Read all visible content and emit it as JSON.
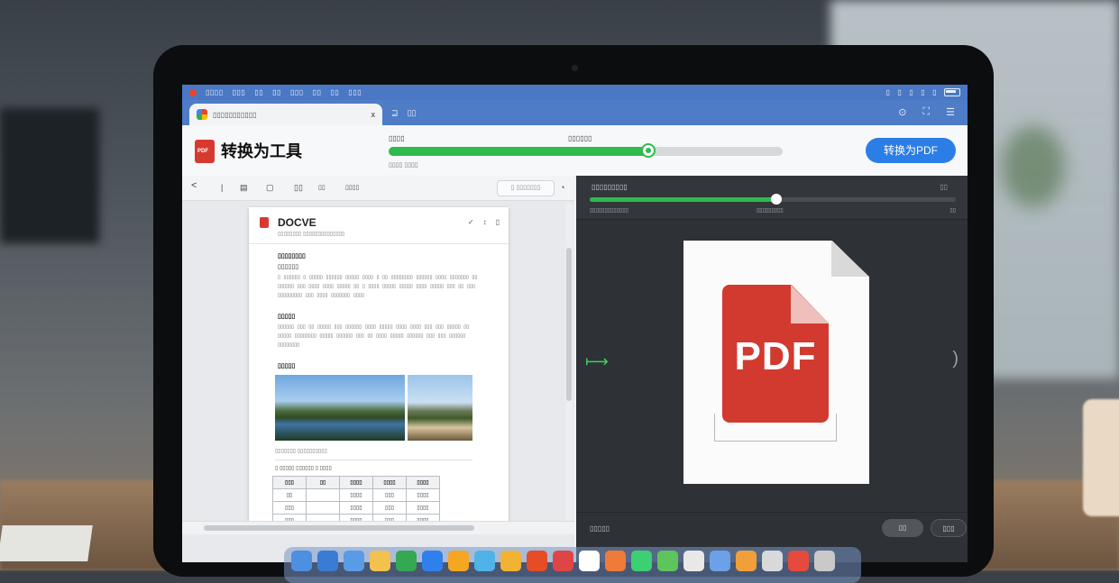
{
  "menubar": {
    "items": [
      "▯▯▯▯",
      "▯▯▯",
      "▯▯",
      "▯▯",
      "▯▯▯",
      "▯▯",
      "▯▯",
      "▯▯▯"
    ],
    "status_icons": [
      "▯",
      "▯",
      "▯",
      "▯",
      "▯"
    ]
  },
  "tab": {
    "label": "▯▯▯▯▯▯▯▯▯▯▯",
    "close": "x",
    "extra_icons": [
      "⊒",
      "▯▯"
    ]
  },
  "toolbar_right": [
    "⊙",
    "⛶",
    "☰"
  ],
  "header": {
    "app_title": "转换为工具",
    "progress_label_left": "▯▯▯▯",
    "progress_label_right": "▯▯▯▯▯▯",
    "progress_sub": "▯▯▯▯ ▯▯▯▯",
    "progress_value": 0.66,
    "convert_button": "转换为PDF"
  },
  "left_toolbar": {
    "back": "<",
    "sep": "|",
    "icons": [
      "▤",
      "▢",
      "▯▯"
    ],
    "labels": [
      "▯▯",
      "▯▯▯▯"
    ],
    "search_placeholder": "▯ ▯▯▯▯▯▯▯"
  },
  "document": {
    "title": "DOCVE",
    "subtitle": "▯▯▯▯▯▯▯▯ ▯▯▯▯▯▯▯▯▯▯▯▯▯▯",
    "tools": [
      "✓",
      "↕",
      "▯"
    ],
    "heading1": "▯▯▯▯▯▯▯▯",
    "heading1b": "▯▯▯▯▯▯",
    "para1": "▯ ▯▯▯▯▯▯ ▯ ▯▯▯▯▯ ▯▯▯▯▯▯ ▯▯▯▯▯ ▯▯▯▯ ▯ ▯▯ ▯▯▯▯▯▯▯▯ ▯▯▯▯▯▯ ▯▯▯▯ ▯▯▯▯▯▯▯ ▯▯ ▯▯▯▯▯▯ ▯▯▯ ▯▯▯▯ ▯▯▯▯ ▯▯▯▯▯ ▯▯ ▯ ▯▯▯▯ ▯▯▯▯▯ ▯▯▯▯▯ ▯▯▯▯ ▯▯▯▯▯ ▯▯▯ ▯▯ ▯▯▯ ▯▯▯▯▯▯▯▯▯ ▯▯▯ ▯▯▯▯ ▯▯▯▯▯▯▯ ▯▯▯▯",
    "heading2": "▯▯▯▯▯",
    "para2": "▯▯▯▯▯▯ ▯▯▯ ▯▯ ▯▯▯▯▯ ▯▯▯ ▯▯▯▯▯▯ ▯▯▯▯ ▯▯▯▯▯ ▯▯▯▯ ▯▯▯▯ ▯▯▯ ▯▯▯ ▯▯▯▯▯ ▯▯ ▯▯▯▯▯ ▯▯▯▯▯▯▯▯ ▯▯▯▯▯ ▯▯▯▯▯▯ ▯▯▯ ▯▯ ▯▯▯▯ ▯▯▯▯▯ ▯▯▯▯▯▯ ▯▯▯ ▯▯▯ ▯▯▯▯▯▯ ▯▯▯▯▯▯▯▯",
    "heading3": "▯▯▯▯▯",
    "caption": "▯▯▯▯▯▯▯ ▯▯▯▯▯▯▯▯▯▯",
    "table_caption": "▯ ▯▯▯▯▯ ▯▯▯▯▯▯ ▯ ▯▯▯▯",
    "table_headers": [
      "▯▯▯",
      "▯▯",
      "▯▯▯▯",
      "▯▯▯▯",
      "▯▯▯▯"
    ],
    "table_rows": [
      [
        "▯▯",
        "",
        "▯▯▯▯",
        "▯▯▯",
        "▯▯▯▯"
      ],
      [
        "▯▯▯",
        "",
        "▯▯▯▯",
        "▯▯▯",
        "▯▯▯▯"
      ],
      [
        "▯▯▯",
        "",
        "▯▯▯▯",
        "▯▯▯",
        "▯▯▯▯"
      ]
    ]
  },
  "right_pane": {
    "top_label": "▯▯▯▯▯▯▯▯▯",
    "top_label_right": "▯▯",
    "progress_value": 0.51,
    "sub_left": "▯▯▯▯▯▯▯▯▯▯▯▯▯",
    "sub_mid": "▯▯▯▯▯▯▯▯▯",
    "sub_right": "▯▯",
    "pdf_label": "PDF",
    "arrow": "⟼",
    "chevron": ")",
    "status": "▯▯▯▯▯",
    "btn_primary": "▯▯",
    "btn_secondary": "▯▯▯"
  },
  "dock": {
    "icon_colors": [
      "#4d8fe0",
      "#3a7bd5",
      "#5a9be8",
      "#f2c14e",
      "#34a853",
      "#2f80ed",
      "#f5a623",
      "#4fb3e8",
      "#f2b233",
      "#e44d26",
      "#e04545",
      "#ffffff",
      "#f07a3a",
      "#3ccf74",
      "#5ec45c",
      "#e8e8e8",
      "#6ca0e8",
      "#f0a03a",
      "#d9d9d9",
      "#e64a3c",
      "#c9c9c9"
    ]
  }
}
